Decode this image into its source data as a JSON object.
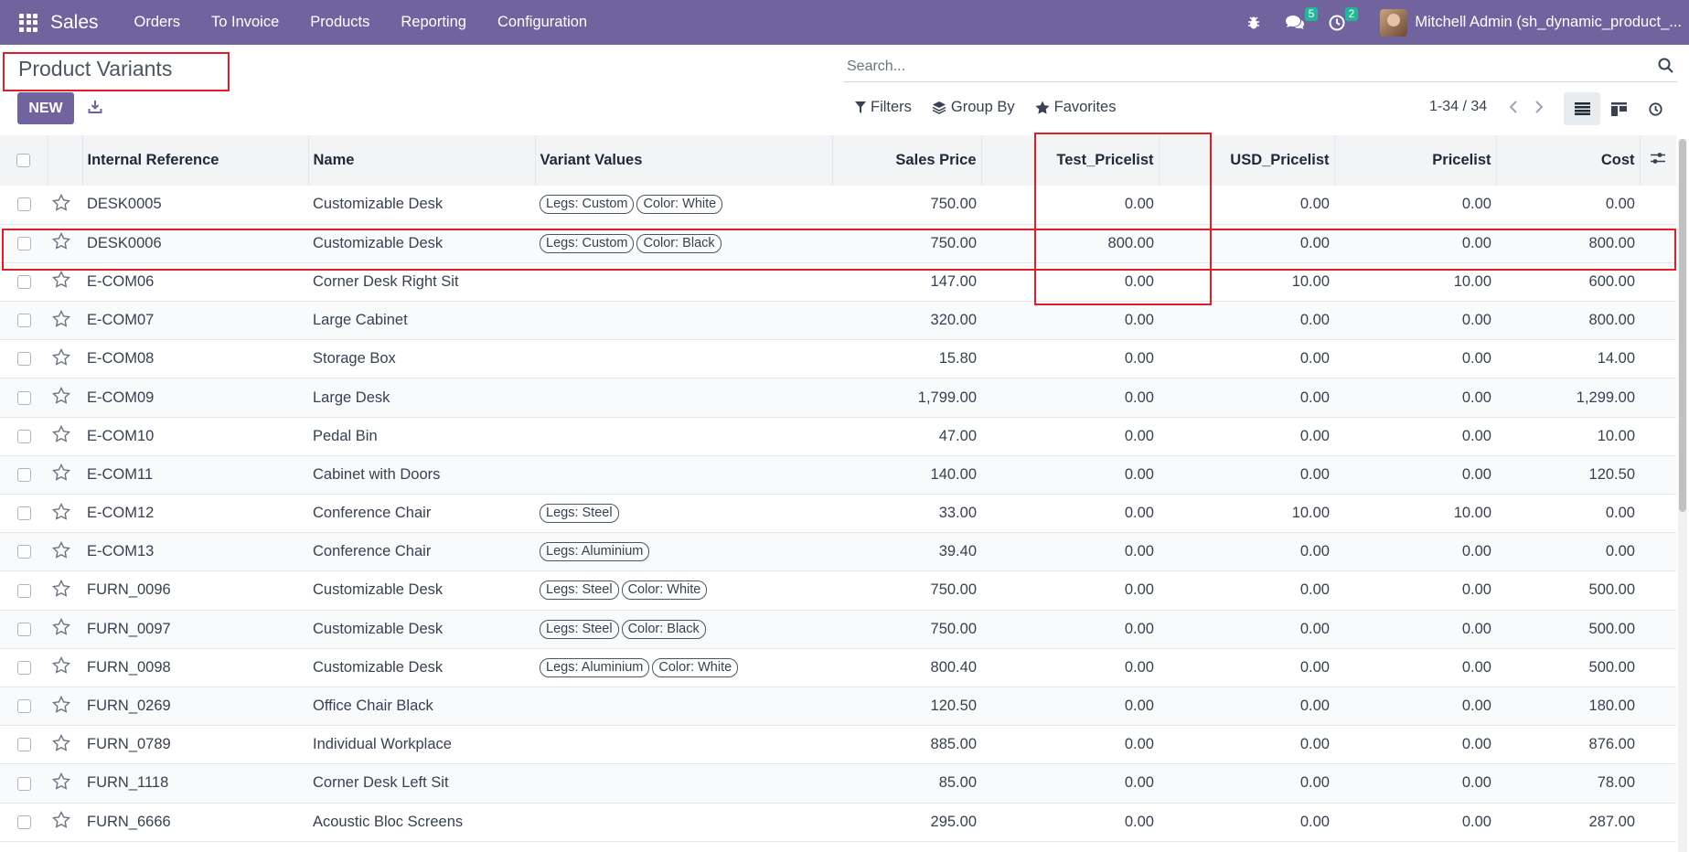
{
  "navbar": {
    "brand": "Sales",
    "menu": [
      "Orders",
      "To Invoice",
      "Products",
      "Reporting",
      "Configuration"
    ],
    "messages_count": "5",
    "activities_count": "2",
    "user_name": "Mitchell Admin (sh_dynamic_product_..."
  },
  "control_panel": {
    "title": "Product Variants",
    "new_label": "NEW",
    "search_placeholder": "Search...",
    "filters_label": "Filters",
    "group_by_label": "Group By",
    "favorites_label": "Favorites",
    "pager": "1-34 / 34"
  },
  "table": {
    "headers": {
      "internal_reference": "Internal Reference",
      "name": "Name",
      "variant_values": "Variant Values",
      "sales_price": "Sales Price",
      "test_pricelist": "Test_Pricelist",
      "usd_pricelist": "USD_Pricelist",
      "pricelist": "Pricelist",
      "cost": "Cost"
    },
    "rows": [
      {
        "ref": "DESK0005",
        "name": "Customizable Desk",
        "variants": [
          "Legs: Custom",
          "Color: White"
        ],
        "sales_price": "750.00",
        "test": "0.00",
        "usd": "0.00",
        "pricelist": "0.00",
        "cost": "0.00"
      },
      {
        "ref": "DESK0006",
        "name": "Customizable Desk",
        "variants": [
          "Legs: Custom",
          "Color: Black"
        ],
        "sales_price": "750.00",
        "test": "800.00",
        "usd": "0.00",
        "pricelist": "0.00",
        "cost": "800.00"
      },
      {
        "ref": "E-COM06",
        "name": "Corner Desk Right Sit",
        "variants": [],
        "sales_price": "147.00",
        "test": "0.00",
        "usd": "10.00",
        "pricelist": "10.00",
        "cost": "600.00"
      },
      {
        "ref": "E-COM07",
        "name": "Large Cabinet",
        "variants": [],
        "sales_price": "320.00",
        "test": "0.00",
        "usd": "0.00",
        "pricelist": "0.00",
        "cost": "800.00"
      },
      {
        "ref": "E-COM08",
        "name": "Storage Box",
        "variants": [],
        "sales_price": "15.80",
        "test": "0.00",
        "usd": "0.00",
        "pricelist": "0.00",
        "cost": "14.00"
      },
      {
        "ref": "E-COM09",
        "name": "Large Desk",
        "variants": [],
        "sales_price": "1,799.00",
        "test": "0.00",
        "usd": "0.00",
        "pricelist": "0.00",
        "cost": "1,299.00"
      },
      {
        "ref": "E-COM10",
        "name": "Pedal Bin",
        "variants": [],
        "sales_price": "47.00",
        "test": "0.00",
        "usd": "0.00",
        "pricelist": "0.00",
        "cost": "10.00"
      },
      {
        "ref": "E-COM11",
        "name": "Cabinet with Doors",
        "variants": [],
        "sales_price": "140.00",
        "test": "0.00",
        "usd": "0.00",
        "pricelist": "0.00",
        "cost": "120.50"
      },
      {
        "ref": "E-COM12",
        "name": "Conference Chair",
        "variants": [
          "Legs: Steel"
        ],
        "sales_price": "33.00",
        "test": "0.00",
        "usd": "10.00",
        "pricelist": "10.00",
        "cost": "0.00"
      },
      {
        "ref": "E-COM13",
        "name": "Conference Chair",
        "variants": [
          "Legs: Aluminium"
        ],
        "sales_price": "39.40",
        "test": "0.00",
        "usd": "0.00",
        "pricelist": "0.00",
        "cost": "0.00"
      },
      {
        "ref": "FURN_0096",
        "name": "Customizable Desk",
        "variants": [
          "Legs: Steel",
          "Color: White"
        ],
        "sales_price": "750.00",
        "test": "0.00",
        "usd": "0.00",
        "pricelist": "0.00",
        "cost": "500.00"
      },
      {
        "ref": "FURN_0097",
        "name": "Customizable Desk",
        "variants": [
          "Legs: Steel",
          "Color: Black"
        ],
        "sales_price": "750.00",
        "test": "0.00",
        "usd": "0.00",
        "pricelist": "0.00",
        "cost": "500.00"
      },
      {
        "ref": "FURN_0098",
        "name": "Customizable Desk",
        "variants": [
          "Legs: Aluminium",
          "Color: White"
        ],
        "sales_price": "800.40",
        "test": "0.00",
        "usd": "0.00",
        "pricelist": "0.00",
        "cost": "500.00"
      },
      {
        "ref": "FURN_0269",
        "name": "Office Chair Black",
        "variants": [],
        "sales_price": "120.50",
        "test": "0.00",
        "usd": "0.00",
        "pricelist": "0.00",
        "cost": "180.00"
      },
      {
        "ref": "FURN_0789",
        "name": "Individual Workplace",
        "variants": [],
        "sales_price": "885.00",
        "test": "0.00",
        "usd": "0.00",
        "pricelist": "0.00",
        "cost": "876.00"
      },
      {
        "ref": "FURN_1118",
        "name": "Corner Desk Left Sit",
        "variants": [],
        "sales_price": "85.00",
        "test": "0.00",
        "usd": "0.00",
        "pricelist": "0.00",
        "cost": "78.00"
      },
      {
        "ref": "FURN_6666",
        "name": "Acoustic Bloc Screens",
        "variants": [],
        "sales_price": "295.00",
        "test": "0.00",
        "usd": "0.00",
        "pricelist": "0.00",
        "cost": "287.00"
      }
    ]
  },
  "colors": {
    "navbar": "#71639e",
    "highlight": "#e11d2a",
    "badge": "#21b799"
  }
}
